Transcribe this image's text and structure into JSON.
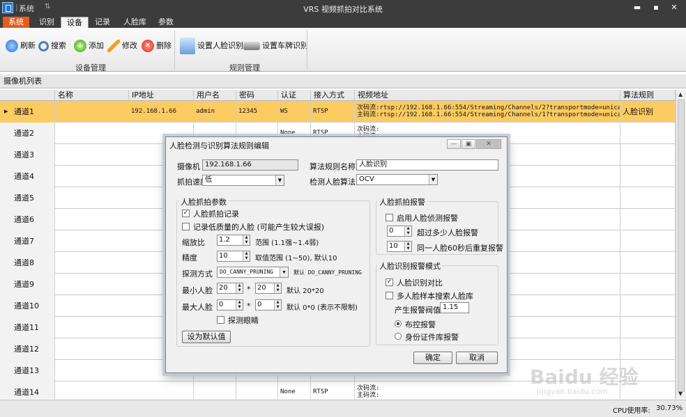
{
  "window": {
    "title": "VRS 视频抓拍对比系统",
    "sys_menu": "系统"
  },
  "menu_tabs": [
    "系统",
    "识别",
    "设备",
    "记录",
    "人脸库",
    "参数"
  ],
  "ribbon": {
    "device_group": {
      "label": "设备管理",
      "buttons": [
        "刷新",
        "搜索",
        "添加",
        "修改",
        "删除"
      ]
    },
    "rule_group": {
      "label": "规则管理",
      "buttons": [
        "设置人脸识别",
        "设置车牌识别"
      ]
    }
  },
  "list": {
    "title": "摄像机列表",
    "columns": [
      "名称",
      "IP地址",
      "用户名",
      "密码",
      "认证",
      "接入方式",
      "视频地址",
      "算法规则"
    ],
    "rows": [
      {
        "name": "通道1",
        "ip": "192.168.1.66",
        "user": "admin",
        "pwd": "12345",
        "auth": "WS",
        "access": "RTSP",
        "url1": "次码流:rtsp://192.168.1.66:554/Streaming/Channels/2?transportmode=unicast",
        "url2": "主码流:rtsp://192.168.1.66:554/Streaming/Channels/1?transportmode=unicast",
        "rule": "人脸识别"
      },
      {
        "name": "通道2",
        "auth": "None",
        "access": "RTSP",
        "url1": "次码流:",
        "url2": "主码流:"
      },
      {
        "name": "通道3"
      },
      {
        "name": "通道4"
      },
      {
        "name": "通道5"
      },
      {
        "name": "通道6"
      },
      {
        "name": "通道7"
      },
      {
        "name": "通道8"
      },
      {
        "name": "通道9"
      },
      {
        "name": "通道10"
      },
      {
        "name": "通道11"
      },
      {
        "name": "通道12"
      },
      {
        "name": "通道13"
      },
      {
        "name": "通道14",
        "auth": "None",
        "access": "RTSP",
        "url1": "次码流:",
        "url2": "主码流:"
      }
    ]
  },
  "status": {
    "cpu_label": "CPU使用率:",
    "cpu_value": "30.73%"
  },
  "dialog": {
    "title": "人脸检测与识别算法规则编辑",
    "camera_label": "摄像机",
    "camera_value": "192.168.1.66",
    "rule_name_label": "算法规则名称",
    "rule_name_value": "人脸识别",
    "capture_speed_label": "抓拍速度",
    "capture_speed_value": "低",
    "detect_algo_label": "检测人脸算法",
    "detect_algo_value": "OCV",
    "capture_params": {
      "title": "人脸抓拍参数",
      "record_capture": "人脸抓拍记录",
      "record_low_quality": "记录低质量的人脸 (可能产生较大误报)",
      "scale_label": "缩放比",
      "scale_value": "1.2",
      "scale_hint": "范围 (1.1强~1.4弱)",
      "precision_label": "精度",
      "precision_value": "10",
      "precision_hint": "取值范围 (1~50), 默认10",
      "detect_mode_label": "探测方式",
      "detect_mode_value": "DO_CANNY_PRUNING",
      "detect_mode_hint": "默认 DO_CANNY_PRUNING",
      "min_face_label": "最小人脸",
      "min_w": "20",
      "min_h": "20",
      "min_hint": "默认 20*20",
      "max_face_label": "最大人脸",
      "max_w": "0",
      "max_h": "0",
      "max_hint": "默认 0*0 (表示不限制)",
      "times": "*",
      "detect_eyes": "探测眼睛",
      "default_button": "设为默认值"
    },
    "capture_alarm": {
      "title": "人脸抓拍报警",
      "enable": "启用人脸侦测报警",
      "over_value": "0",
      "over_label": "超过多少人脸报警",
      "repeat_value": "10",
      "repeat_label": "同一人脸60秒后重复报警"
    },
    "recog_alarm": {
      "title": "人脸识别报警模式",
      "compare": "人脸识别对比",
      "multi_search": "多人脸样本搜索人脸库",
      "threshold_label": "产生报警阀值",
      "threshold_value": "1.15",
      "mode_patrol": "布控报警",
      "mode_id": "身份证件库报警"
    },
    "ok": "确定",
    "cancel": "取消"
  }
}
